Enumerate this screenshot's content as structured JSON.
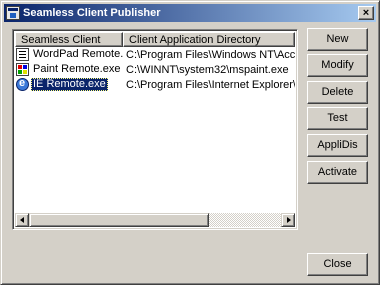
{
  "window": {
    "title": "Seamless Client Publisher",
    "close_glyph": "×",
    "icon": "publisher-app-icon"
  },
  "list": {
    "columns": [
      "Seamless Client",
      "Client Application Directory"
    ],
    "rows": [
      {
        "name": "WordPad Remote.exe",
        "directory": "C:\\Program Files\\Windows NT\\Accessorie...",
        "icon": "wordpad-icon",
        "selected": false
      },
      {
        "name": "Paint Remote.exe",
        "directory": "C:\\WINNT\\system32\\mspaint.exe",
        "icon": "paint-icon",
        "selected": false
      },
      {
        "name": "IE Remote.exe",
        "directory": "C:\\Program Files\\Internet Explorer\\IEXPLO...",
        "icon": "internet-explorer-icon",
        "selected": true
      }
    ],
    "horizontal_scroll_fraction": 0.0
  },
  "buttons": {
    "new": "New",
    "modify": "Modify",
    "delete": "Delete",
    "test": "Test",
    "applidis": "AppliDis",
    "activate": "Activate",
    "close": "Close"
  },
  "colors": {
    "title_gradient_start": "#0a246a",
    "title_gradient_end": "#a6caf0",
    "selection": "#0a246a",
    "face": "#d4d0c8"
  }
}
